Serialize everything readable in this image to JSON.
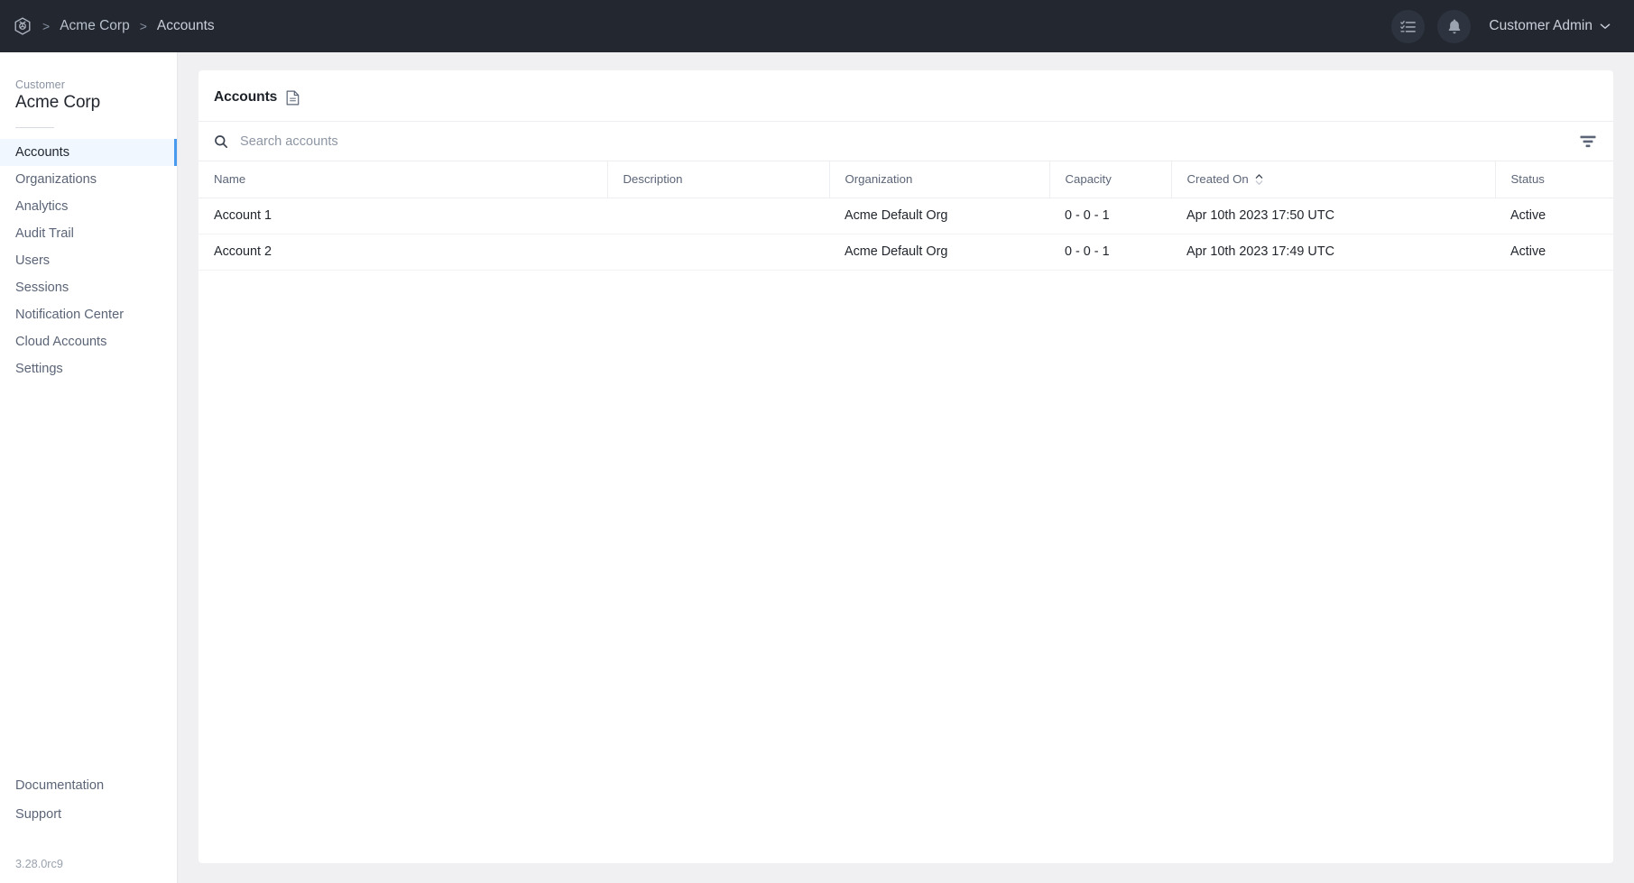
{
  "topbar": {
    "logo_icon": "cube-icon",
    "breadcrumb": {
      "separator": ">",
      "org": "Acme Corp",
      "current": "Accounts"
    },
    "tasks_icon": "checklist-icon",
    "notifications_icon": "bell-icon",
    "user_name": "Customer Admin",
    "user_chevron_icon": "chevron-down-icon"
  },
  "sidebar": {
    "customer_label": "Customer",
    "customer_name": "Acme Corp",
    "items": [
      {
        "label": "Accounts",
        "active": true
      },
      {
        "label": "Organizations",
        "active": false
      },
      {
        "label": "Analytics",
        "active": false
      },
      {
        "label": "Audit Trail",
        "active": false
      },
      {
        "label": "Users",
        "active": false
      },
      {
        "label": "Sessions",
        "active": false
      },
      {
        "label": "Notification Center",
        "active": false
      },
      {
        "label": "Cloud Accounts",
        "active": false
      },
      {
        "label": "Settings",
        "active": false
      }
    ],
    "footer_links": [
      {
        "label": "Documentation"
      },
      {
        "label": "Support"
      }
    ],
    "version": "3.28.0rc9"
  },
  "main": {
    "title": "Accounts",
    "title_icon": "document-icon",
    "search": {
      "icon": "search-icon",
      "placeholder": "Search accounts",
      "value": ""
    },
    "filter_icon": "filter-icon",
    "table": {
      "columns": [
        {
          "key": "name",
          "label": "Name",
          "sorted": false
        },
        {
          "key": "description",
          "label": "Description",
          "sorted": false
        },
        {
          "key": "organization",
          "label": "Organization",
          "sorted": false
        },
        {
          "key": "capacity",
          "label": "Capacity",
          "sorted": false
        },
        {
          "key": "created_on",
          "label": "Created On",
          "sorted": true,
          "sort_icon": "sort-arrows-icon"
        },
        {
          "key": "status",
          "label": "Status",
          "sorted": false
        }
      ],
      "rows": [
        {
          "name": "Account 1",
          "description": "",
          "organization": "Acme Default Org",
          "capacity": "0 - 0 - 1",
          "created_on": "Apr 10th 2023 17:50 UTC",
          "status": "Active"
        },
        {
          "name": "Account 2",
          "description": "",
          "organization": "Acme Default Org",
          "capacity": "0 - 0 - 1",
          "created_on": "Apr 10th 2023 17:49 UTC",
          "status": "Active"
        }
      ]
    }
  },
  "colors": {
    "topbar_bg": "#222730",
    "page_bg": "#f0f0f2",
    "accent_blue": "#4a9af0",
    "active_item_bg": "#f0f7fe",
    "text_primary": "#22262e",
    "text_secondary": "#5b6577"
  }
}
